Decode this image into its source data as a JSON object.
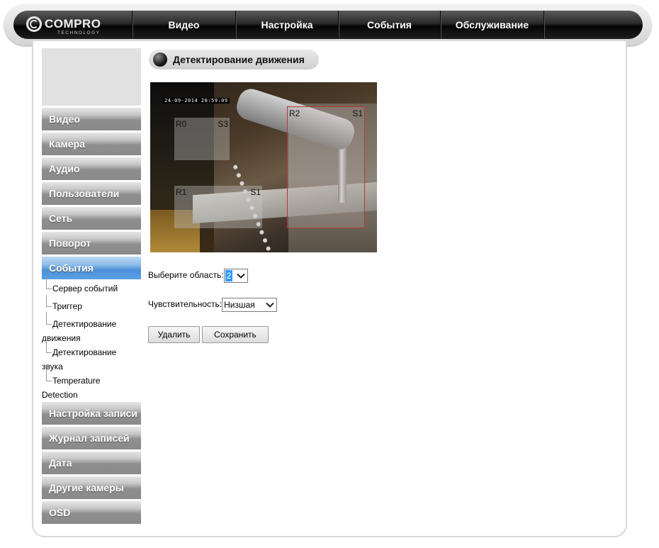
{
  "brand": {
    "name": "COMPRO",
    "sub": "TECHNOLOGY"
  },
  "nav": {
    "items": [
      {
        "label": "Видео"
      },
      {
        "label": "Настройка"
      },
      {
        "label": "События"
      },
      {
        "label": "Обслуживание"
      }
    ]
  },
  "sidebar": {
    "items": [
      {
        "label": "Видео"
      },
      {
        "label": "Камера"
      },
      {
        "label": "Аудио"
      },
      {
        "label": "Пользователи"
      },
      {
        "label": "Сеть"
      },
      {
        "label": "Поворот"
      },
      {
        "label": "События"
      },
      {
        "label": "Настройка записи"
      },
      {
        "label": "Журнал записей"
      },
      {
        "label": "Дата"
      },
      {
        "label": "Другие камеры"
      },
      {
        "label": "OSD"
      }
    ],
    "active_index": 6,
    "submenu": [
      {
        "line1": "Сервер событий",
        "line2": ""
      },
      {
        "line1": "Триггер",
        "line2": ""
      },
      {
        "line1": "Детектирование",
        "line2": "движения"
      },
      {
        "line1": "Детектирование",
        "line2": "звука"
      },
      {
        "line1": "Temperature",
        "line2": "Detection"
      }
    ]
  },
  "page": {
    "title": "Детектирование движения"
  },
  "camera": {
    "timestamp": "24-09-2014 20:59:09",
    "regions": [
      {
        "region": "R0",
        "sens": "S3"
      },
      {
        "region": "R2",
        "sens": "S1"
      },
      {
        "region": "R1",
        "sens": "S1"
      }
    ]
  },
  "form": {
    "area_label": "Выберите область:",
    "area_value": "2",
    "sensitivity_label": "Чувствительность:",
    "sensitivity_value": "Низшая",
    "delete_label": "Удалить",
    "save_label": "Сохранить"
  }
}
